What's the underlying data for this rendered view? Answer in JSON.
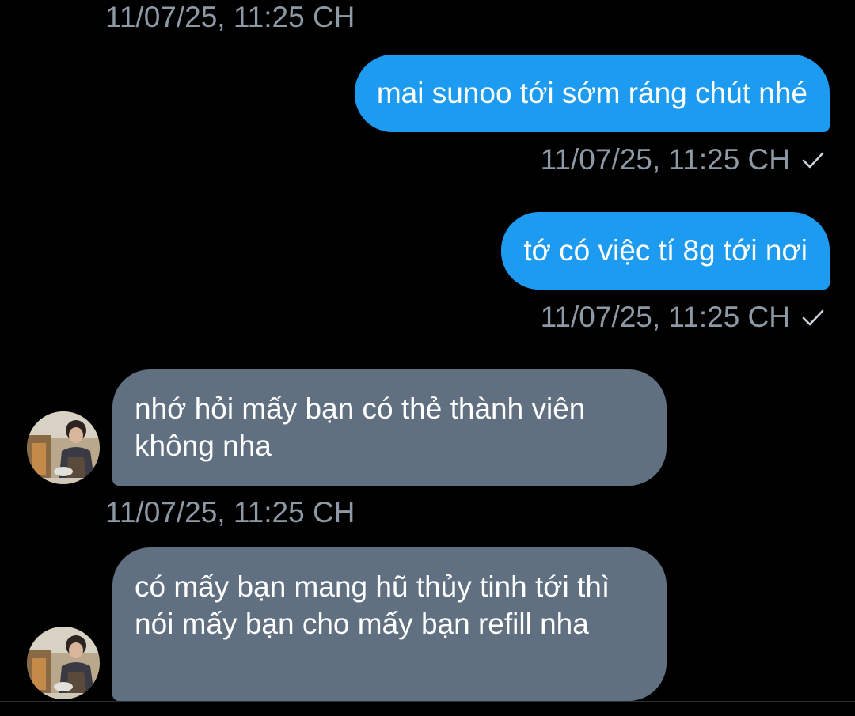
{
  "conversation": {
    "messages": [
      {
        "direction": "incoming",
        "timestamp": "11/07/25, 11:25 CH"
      },
      {
        "direction": "outgoing",
        "text": "mai sunoo tới sớm ráng chút nhé",
        "timestamp": "11/07/25, 11:25 CH",
        "status": "check-icon"
      },
      {
        "direction": "outgoing",
        "text": "tớ có việc tí 8g tới nơi",
        "timestamp": "11/07/25, 11:25 CH",
        "status": "check-icon"
      },
      {
        "direction": "incoming",
        "text": "nhớ hỏi mấy bạn có thẻ thành viên không nha",
        "timestamp": "11/07/25, 11:25 CH"
      },
      {
        "direction": "incoming",
        "text": "có mấy bạn mang hũ thủy tinh tới thì nói mấy bạn cho mấy bạn refill nha"
      }
    ]
  },
  "colors": {
    "background": "#000000",
    "outgoing_bubble": "#1d9bf0",
    "incoming_bubble": "#607080",
    "timestamp": "#8e99a6"
  }
}
